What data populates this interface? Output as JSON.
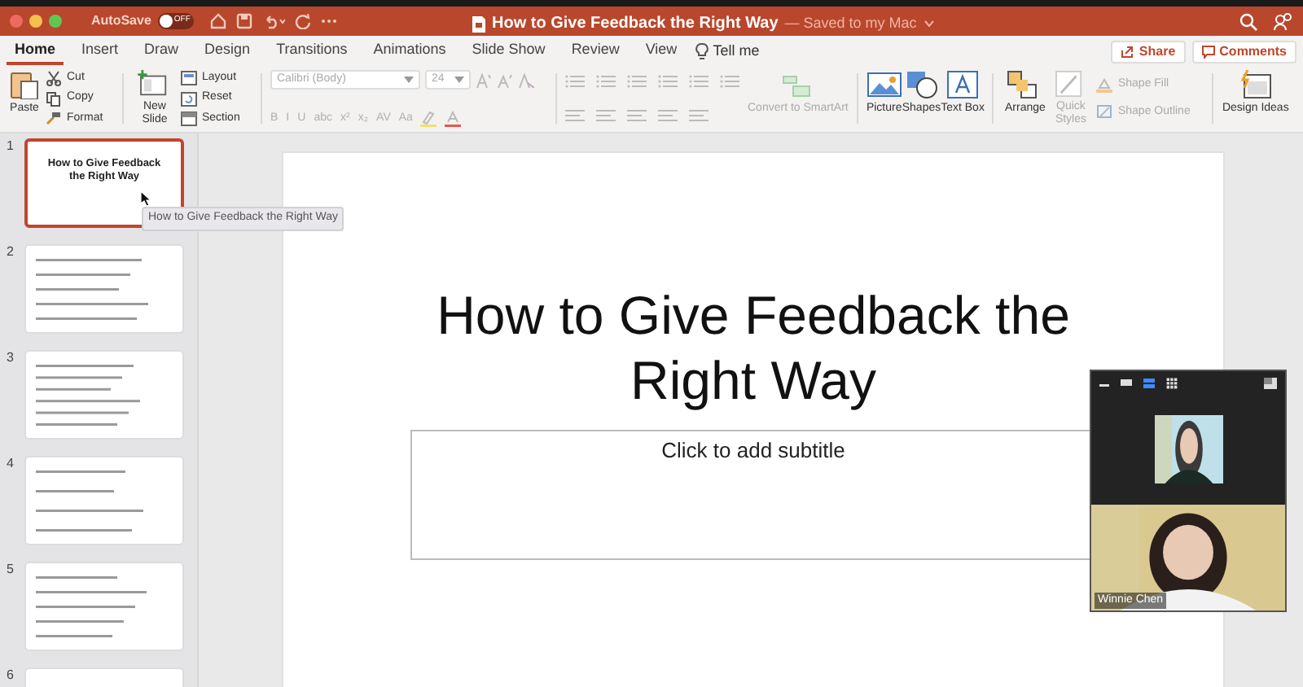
{
  "window": {
    "title": "How to Give Feedback the Right Way",
    "saved_status": "— Saved to my Mac"
  },
  "autosave": {
    "label": "AutoSave",
    "on": false,
    "state_label": "OFF"
  },
  "tabs": [
    {
      "label": "Home",
      "selected": true
    },
    {
      "label": "Insert",
      "selected": false
    },
    {
      "label": "Draw",
      "selected": false
    },
    {
      "label": "Design",
      "selected": false
    },
    {
      "label": "Transitions",
      "selected": false
    },
    {
      "label": "Animations",
      "selected": false
    },
    {
      "label": "Slide Show",
      "selected": false
    },
    {
      "label": "Review",
      "selected": false
    },
    {
      "label": "View",
      "selected": false
    }
  ],
  "tell_me": "Tell me",
  "share_button": "Share",
  "comments_button": "Comments",
  "clipboard": {
    "paste": "Paste",
    "items": [
      {
        "kind": "cut",
        "label": "Cut"
      },
      {
        "kind": "copy",
        "label": "Copy"
      },
      {
        "kind": "format",
        "label": "Format"
      }
    ]
  },
  "slides_group": {
    "new_slide": "New Slide",
    "items": [
      {
        "kind": "layout",
        "label": "Layout"
      },
      {
        "kind": "reset",
        "label": "Reset"
      },
      {
        "kind": "section",
        "label": "Section"
      }
    ]
  },
  "font": {
    "name": "Calibri (Body)",
    "size": "24",
    "format_buttons": [
      "B",
      "I",
      "U",
      "abc",
      "x²",
      "x₂",
      "AV",
      "Aa"
    ],
    "disabled": true
  },
  "smartart": {
    "label": "Convert to SmartArt",
    "disabled": true
  },
  "insert_group": [
    {
      "kind": "picture",
      "label": "Picture",
      "disabled": false
    },
    {
      "kind": "shapes",
      "label": "Shapes",
      "disabled": false
    },
    {
      "kind": "textbox",
      "label": "Text Box",
      "disabled": false
    }
  ],
  "arrange_group": [
    {
      "kind": "arrange",
      "label": "Arrange",
      "disabled": false
    },
    {
      "kind": "quickstyles",
      "label": "Quick Styles",
      "disabled": true
    }
  ],
  "shape_options": [
    {
      "kind": "fill",
      "label": "Shape Fill",
      "disabled": true
    },
    {
      "kind": "outline",
      "label": "Shape Outline",
      "disabled": true
    }
  ],
  "design_ideas": "Design Ideas",
  "slides": [
    {
      "number": "1",
      "kind": "title",
      "title": "How to Give Feedback the Right Way",
      "selected": true
    },
    {
      "number": "2",
      "kind": "bullets",
      "selected": false
    },
    {
      "number": "3",
      "kind": "bullets",
      "selected": false
    },
    {
      "number": "4",
      "kind": "bullets",
      "selected": false
    },
    {
      "number": "5",
      "kind": "bullets",
      "selected": false
    },
    {
      "number": "6",
      "kind": "blank",
      "selected": false
    }
  ],
  "tooltip": "How to Give Feedback the Right Way",
  "slide": {
    "title": "How to Give Feedback the Right Way",
    "subtitle_placeholder": "Click to add subtitle"
  },
  "video": {
    "participants": [
      {
        "kind": "thumbnail"
      },
      {
        "kind": "main",
        "name": "Winnie Chen"
      }
    ]
  }
}
